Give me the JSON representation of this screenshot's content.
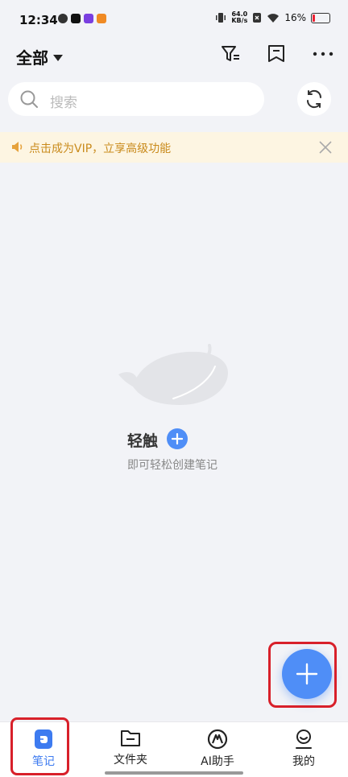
{
  "status_bar": {
    "time": "12:34",
    "net_speed_value": "64.0",
    "net_speed_unit": "KB/s",
    "battery": "16%"
  },
  "header": {
    "folder_label": "全部"
  },
  "search": {
    "placeholder": "搜索"
  },
  "vip_banner": {
    "text": "点击成为VIP，立享高级功能"
  },
  "empty_state": {
    "title": "轻触",
    "subtitle": "即可轻松创建笔记"
  },
  "bottom_nav": {
    "items": [
      {
        "label": "笔记",
        "icon": "note-icon",
        "active": true
      },
      {
        "label": "文件夹",
        "icon": "folder-icon",
        "active": false
      },
      {
        "label": "AI助手",
        "icon": "ai-icon",
        "active": false
      },
      {
        "label": "我的",
        "icon": "profile-icon",
        "active": false
      }
    ]
  },
  "colors": {
    "accent": "#4f8ef7",
    "active_nav": "#3d7bf0",
    "banner_bg": "#fdf5e2",
    "banner_text": "#c98a1b",
    "highlight": "#d8202a"
  }
}
